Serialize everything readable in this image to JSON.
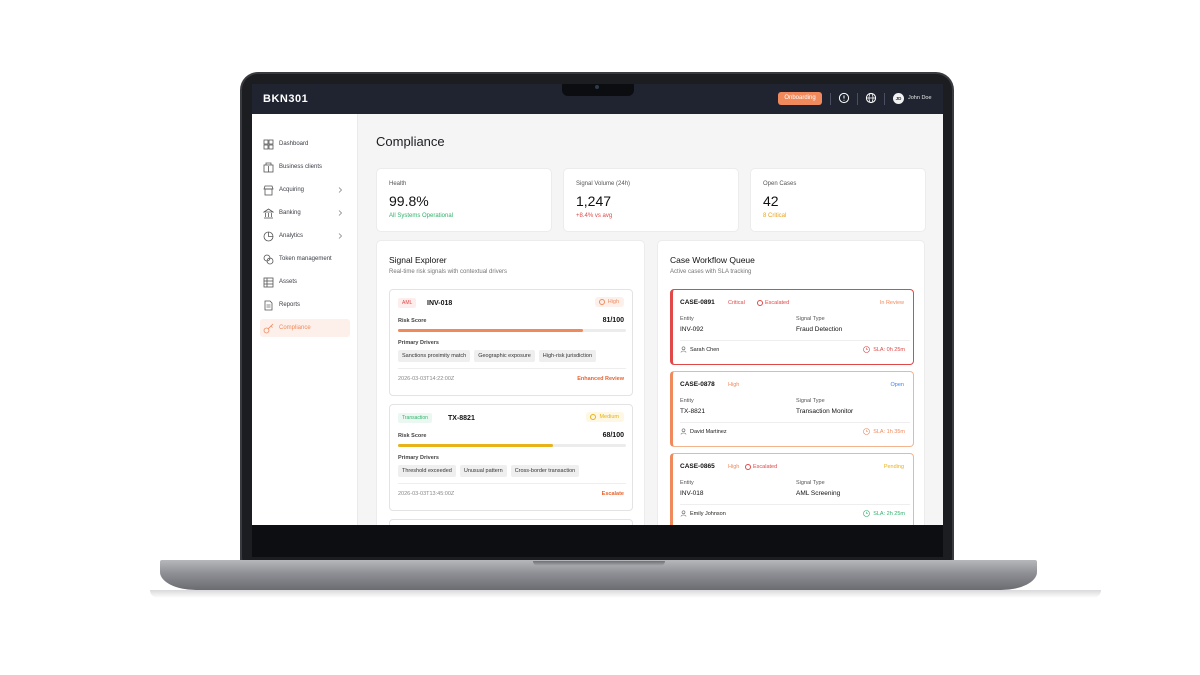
{
  "app": {
    "logo": "BKN301"
  },
  "topbar": {
    "onboarding_label": "Onboarding",
    "avatar_initials": "JD",
    "user_name": "John Doe"
  },
  "sidebar": {
    "items": [
      {
        "label": "Dashboard",
        "icon": "dashboard-icon"
      },
      {
        "label": "Business clients",
        "icon": "building-icon"
      },
      {
        "label": "Acquiring",
        "icon": "store-icon"
      },
      {
        "label": "Banking",
        "icon": "bank-icon"
      },
      {
        "label": "Analytics",
        "icon": "pie-chart-icon"
      },
      {
        "label": "Token management",
        "icon": "token-icon"
      },
      {
        "label": "Assets",
        "icon": "assets-icon"
      },
      {
        "label": "Reports",
        "icon": "document-icon"
      },
      {
        "label": "Compliance",
        "icon": "key-icon"
      }
    ],
    "active": "Compliance"
  },
  "page": {
    "title": "Compliance"
  },
  "stats": [
    {
      "label": "Health",
      "value": "99.8%",
      "sub": "All Systems Operational",
      "sub_color": "#2fb36b"
    },
    {
      "label": "Signal Volume (24h)",
      "value": "1,247",
      "sub": "+8.4% vs avg",
      "sub_color": "#e14848"
    },
    {
      "label": "Open Cases",
      "value": "42",
      "sub": "8 Critical",
      "sub_color": "#e8a21a"
    }
  ],
  "signal_explorer": {
    "title": "Signal Explorer",
    "subtitle": "Real-time risk signals with contextual drivers",
    "risk_label": "Risk Score",
    "drivers_label": "Primary Drivers",
    "signals": [
      {
        "type": "AML",
        "id": "INV-018",
        "severity": "High",
        "score": "81/100",
        "score_pct": 0.81,
        "drivers": [
          "Sanctions proximity match",
          "Geographic exposure",
          "High-risk jurisdiction"
        ],
        "timestamp": "2026-03-03T14:22:00Z",
        "action": "Enhanced Review"
      },
      {
        "type": "Transaction",
        "id": "TX-8821",
        "severity": "Medium",
        "score": "68/100",
        "score_pct": 0.68,
        "drivers": [
          "Threshold exceeded",
          "Unusual pattern",
          "Cross-border transaction"
        ],
        "timestamp": "2026-03-03T13:45:00Z",
        "action": "Escalate"
      }
    ]
  },
  "case_queue": {
    "title": "Case Workflow Queue",
    "subtitle": "Active cases with SLA tracking",
    "entity_label": "Entity",
    "signal_type_label": "Signal Type",
    "cases": [
      {
        "id": "CASE-0891",
        "severity": "Critical",
        "escalated": "Escalated",
        "status": "In Review",
        "entity": "INV-092",
        "signal_type": "Fraud Detection",
        "assignee": "Sarah Chen",
        "sla": "SLA: 0h 25m"
      },
      {
        "id": "CASE-0878",
        "severity": "High",
        "escalated": "",
        "status": "Open",
        "entity": "TX-8821",
        "signal_type": "Transaction Monitor",
        "assignee": "David Martinez",
        "sla": "SLA: 1h 35m"
      },
      {
        "id": "CASE-0865",
        "severity": "High",
        "escalated": "Escalated",
        "status": "Pending",
        "entity": "INV-018",
        "signal_type": "AML Screening",
        "assignee": "Emily Johnson",
        "sla": "SLA: 2h 25m"
      }
    ]
  },
  "colors": {
    "accent": "#f08a5d",
    "topbar": "#1f2430",
    "critical": "#e14848",
    "high": "#f08a5d",
    "medium": "#e8b21a",
    "ok": "#2fb36b",
    "open": "#3b82f6"
  }
}
